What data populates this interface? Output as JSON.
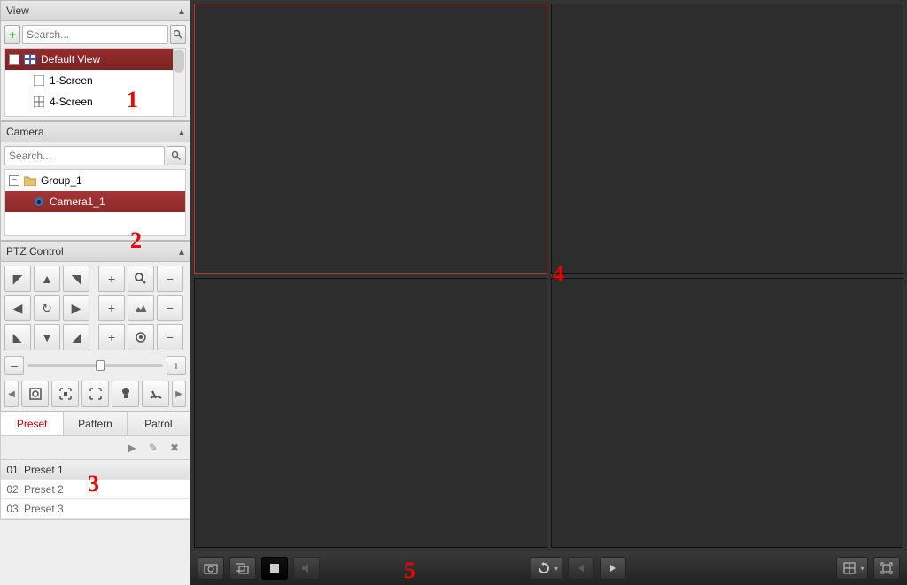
{
  "annotations": {
    "a1": "1",
    "a2": "2",
    "a3": "3",
    "a4": "4",
    "a5": "5"
  },
  "view_panel": {
    "title": "View",
    "search_placeholder": "Search...",
    "root": "Default View",
    "items": [
      "1-Screen",
      "4-Screen"
    ]
  },
  "camera_panel": {
    "title": "Camera",
    "search_placeholder": "Search...",
    "group": "Group_1",
    "camera": "Camera1_1"
  },
  "ptz_panel": {
    "title": "PTZ Control",
    "tabs": {
      "preset": "Preset",
      "pattern": "Pattern",
      "patrol": "Patrol"
    },
    "presets": [
      {
        "num": "01",
        "label": "Preset 1"
      },
      {
        "num": "02",
        "label": "Preset 2"
      },
      {
        "num": "03",
        "label": "Preset 3"
      }
    ],
    "slider_minus": "–",
    "slider_plus": "+"
  },
  "toolbar": {}
}
